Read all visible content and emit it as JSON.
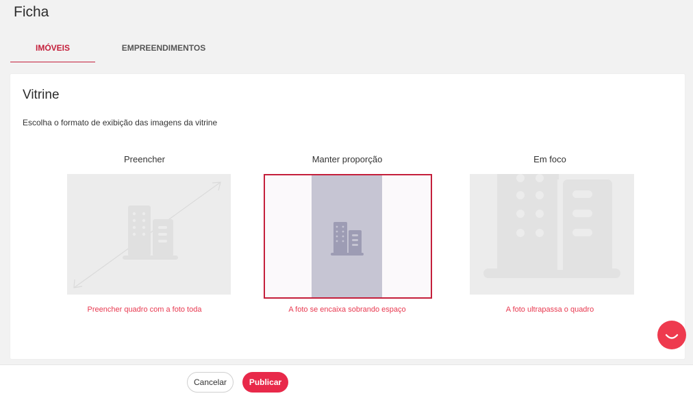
{
  "page": {
    "title": "Ficha"
  },
  "tabs": [
    {
      "label": "IMÓVEIS",
      "active": true
    },
    {
      "label": "EMPREENDIMENTOS",
      "active": false
    }
  ],
  "vitrine": {
    "title": "Vitrine",
    "description": "Escolha o formato de exibição das imagens da vitrine",
    "options": [
      {
        "label": "Preencher",
        "caption": "Preencher quadro com a foto toda",
        "selected": false
      },
      {
        "label": "Manter proporção",
        "caption": "A foto se encaixa sobrando espaço",
        "selected": true
      },
      {
        "label": "Em foco",
        "caption": "A foto ultrapassa o quadro",
        "selected": false
      }
    ]
  },
  "footer": {
    "cancel_label": "Cancelar",
    "publish_label": "Publicar"
  },
  "colors": {
    "accent": "#e8294a",
    "active_tab": "#c41e3a",
    "caption": "#e8384f"
  },
  "icons": {
    "building": "building-icon",
    "resize": "diagonal-resize-icon",
    "chat": "chat-icon"
  }
}
